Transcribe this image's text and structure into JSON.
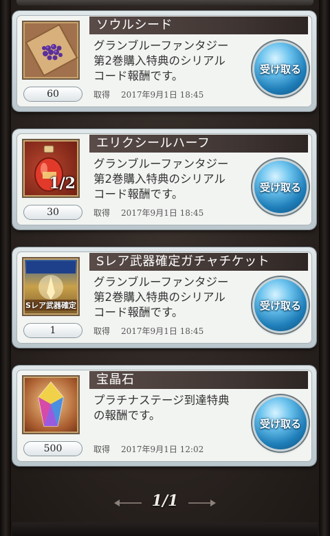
{
  "items": [
    {
      "name": "ソウルシード",
      "description": "グランブルーファンタジー\n第2巻購入特典のシリアル\nコード報酬です。",
      "quantity": "60",
      "date_label": "取得",
      "date": "2017年9月1日 18:45",
      "receive_label": "受け取る",
      "icon": "soul-seed-icon"
    },
    {
      "name": "エリクシールハーフ",
      "description": "グランブルーファンタジー\n第2巻購入特典のシリアル\nコード報酬です。",
      "quantity": "30",
      "date_label": "取得",
      "date": "2017年9月1日 18:45",
      "receive_label": "受け取る",
      "icon": "elixir-half-icon",
      "icon_overlay": "1/2"
    },
    {
      "name": "Sレア武器確定ガチャチケット",
      "description": "グランブルーファンタジー\n第2巻購入特典のシリアル\nコード報酬です。",
      "quantity": "1",
      "date_label": "取得",
      "date": "2017年9月1日 18:45",
      "receive_label": "受け取る",
      "icon": "gacha-ticket-icon",
      "icon_overlay": "Sレア武器確定"
    },
    {
      "name": "宝晶石",
      "description": "プラチナステージ到達特典\nの報酬です。",
      "quantity": "500",
      "date_label": "取得",
      "date": "2017年9月1日 12:02",
      "receive_label": "受け取る",
      "icon": "crystal-icon"
    }
  ],
  "pager": {
    "label": "1/1"
  }
}
